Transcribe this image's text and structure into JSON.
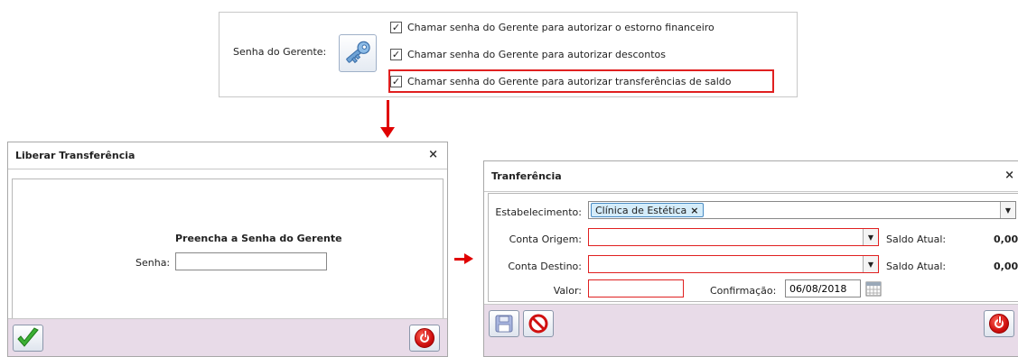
{
  "settings": {
    "label": "Senha do Gerente:",
    "options": [
      {
        "label": "Chamar senha do Gerente para autorizar o estorno financeiro",
        "checked": true
      },
      {
        "label": "Chamar senha do Gerente para autorizar descontos",
        "checked": true
      },
      {
        "label": "Chamar senha do Gerente para autorizar transferências de saldo",
        "checked": true
      }
    ],
    "check_mark": "✓"
  },
  "dialog_liberar": {
    "title": "Liberar Transferência",
    "close": "×",
    "heading": "Preencha a Senha do Gerente",
    "senha_label": "Senha:",
    "senha_value": ""
  },
  "dialog_transferencia": {
    "title": "Tranferência",
    "close": "×",
    "estabelecimento_label": "Estabelecimento:",
    "estabelecimento_tag": "Clínica de Estética",
    "tag_remove": "×",
    "conta_origem_label": "Conta Origem:",
    "conta_origem_value": "",
    "conta_destino_label": "Conta Destino:",
    "conta_destino_value": "",
    "saldo_label": "Saldo Atual:",
    "saldo_origem": "0,00",
    "saldo_destino": "0,00",
    "valor_label": "Valor:",
    "valor_value": "",
    "confirmacao_label": "Confirmação:",
    "confirmacao_value": "06/08/2018",
    "dropdown_arrow": "▼"
  },
  "colors": {
    "highlight": "#e02020",
    "arrow": "#e00000",
    "footer": "#e8dbe8"
  }
}
